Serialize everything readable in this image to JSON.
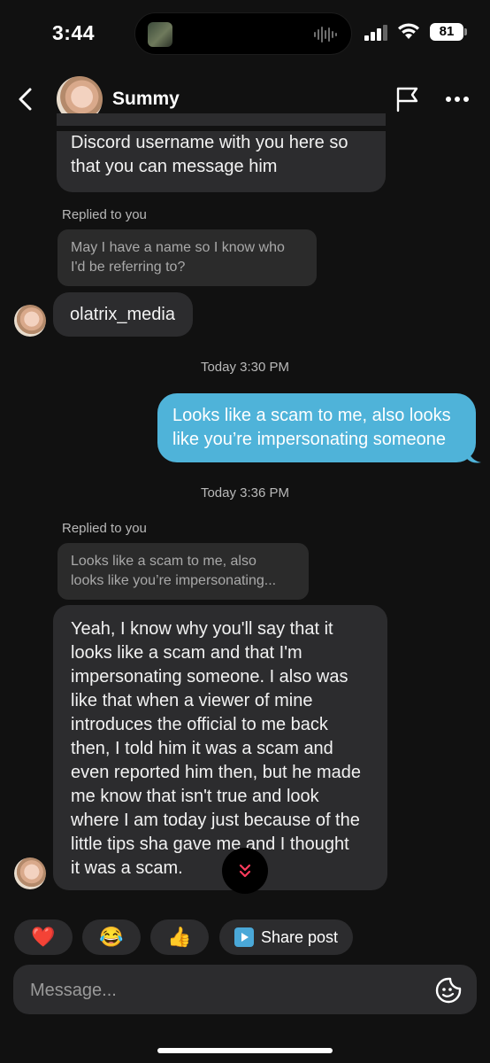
{
  "status_bar": {
    "time": "3:44",
    "battery": "81"
  },
  "header": {
    "name": "Summy"
  },
  "messages": {
    "first_bubble": {
      "line1": "Discord username with you here so",
      "line2": "that you can message him"
    },
    "reply1": {
      "label": "Replied to you",
      "quote_line1": "May I have a name so I know who",
      "quote_line2": "I'd be referring to?",
      "answer": "olatrix_media"
    },
    "timestamp1": "Today 3:30 PM",
    "outgoing": {
      "line1": "Looks like a scam to me, also looks",
      "line2": "like you’re impersonating someone"
    },
    "timestamp2": "Today 3:36 PM",
    "reply2": {
      "label": "Replied to you",
      "quote_line1": "Looks like a scam to me, also",
      "quote_line2": "looks like you’re impersonating...",
      "lines": [
        "Yeah, I know why you'll say that it",
        "looks like a scam and that I'm",
        "impersonating someone. I also was",
        "like that when a viewer of mine",
        "introduces the official to me back",
        "then, I told him it was a scam and",
        "even reported him then, but he made",
        "me know that isn't true and look",
        "where I am today just because of the",
        "little tips sha gave me and I thought",
        "it was a scam."
      ]
    }
  },
  "reactions": {
    "heart": "❤️",
    "laugh": "😂",
    "thumbs": "👍",
    "share_label": "Share post"
  },
  "composer": {
    "placeholder": "Message..."
  },
  "icons": {
    "back": "chevron-left-icon",
    "flag": "flag-icon",
    "more": "more-horizontal-icon",
    "scroll": "chevron-double-down-icon",
    "sticker": "sticker-icon",
    "share": "play-square-icon"
  },
  "colors": {
    "outgoing_bubble": "#4fb3d9",
    "incoming_bubble": "#2c2c2e",
    "background": "#111111",
    "scroll_chevron": "#ff3b5c"
  }
}
